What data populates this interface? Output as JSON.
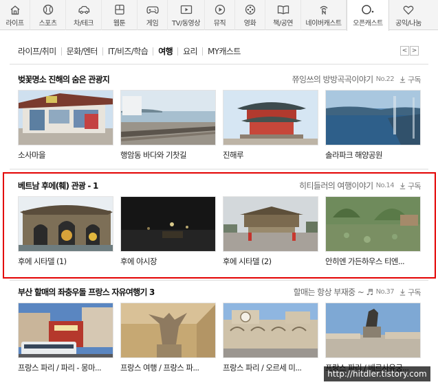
{
  "top_nav": [
    {
      "label": "라이프",
      "icon": "house-icon"
    },
    {
      "label": "스포츠",
      "icon": "baseball-icon"
    },
    {
      "label": "차/테크",
      "icon": "car-icon"
    },
    {
      "label": "웹툰",
      "icon": "webtoon-icon"
    },
    {
      "label": "게임",
      "icon": "gamepad-icon"
    },
    {
      "label": "TV/동영상",
      "icon": "tv-play-icon"
    },
    {
      "label": "뮤직",
      "icon": "play-circle-icon"
    },
    {
      "label": "영화",
      "icon": "film-reel-icon"
    },
    {
      "label": "책/공연",
      "icon": "book-icon"
    },
    {
      "label": "네이버캐스트",
      "icon": "naver-cast-icon"
    },
    {
      "label": "오픈캐스트",
      "icon": "opencast-icon"
    },
    {
      "label": "공익/나눔",
      "icon": "heart-icon"
    }
  ],
  "submenu": [
    "라이프/취미",
    "문화/엔터",
    "IT/비즈/학습",
    "여행",
    "요리",
    "MY캐스트"
  ],
  "submenu_active": "여행",
  "pager": {
    "prev": "<",
    "next": ">"
  },
  "sections": [
    {
      "title": "벚꽃명소 진해의 숨은 관광지",
      "author": "쮸잉쓰의 방방곡곡이야기",
      "number": "No.22",
      "subscribe": "구독",
      "cards": [
        {
          "caption": "소사마을"
        },
        {
          "caption": "행암동 바다와 기찻길"
        },
        {
          "caption": "진해루"
        },
        {
          "caption": "솔라파크 해양공원"
        }
      ]
    },
    {
      "title": "베트남 후에(훼) 관광 - 1",
      "author": "히티들러의 여행이야기",
      "number": "No.14",
      "subscribe": "구독",
      "cards": [
        {
          "caption": "후에 시타델 (1)"
        },
        {
          "caption": "후에 야시장"
        },
        {
          "caption": "후에 시타델 (2)"
        },
        {
          "caption": "안히엔 가든하우스 티엔..."
        }
      ]
    },
    {
      "title": "부산 할매의 좌충우돌 프랑스 자유여행기 3",
      "author": "할매는 항상 부재중 ~ ♬",
      "number": "No.37",
      "subscribe": "구독",
      "cards": [
        {
          "caption": "프랑스 파리 / 파리 - 몽마..."
        },
        {
          "caption": "프랑스 여행 / 프랑스 파..."
        },
        {
          "caption": "프랑스 파리 / 오르세 미..."
        },
        {
          "caption": "프랑스 파리 / 베르사유궁..."
        }
      ]
    }
  ],
  "watermark": "http://hitdler.tistory.com"
}
